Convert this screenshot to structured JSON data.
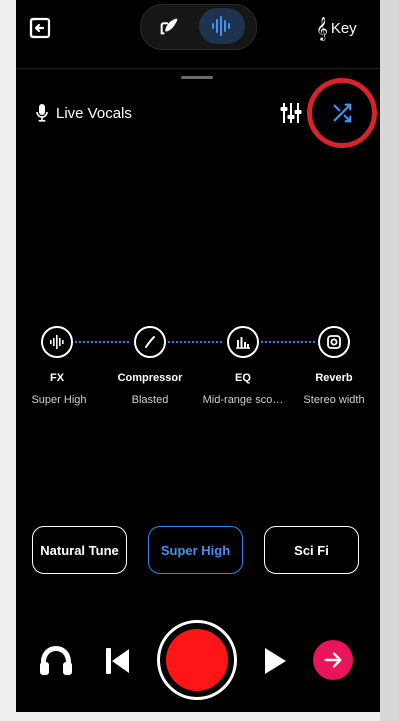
{
  "header": {
    "key_label": "Key",
    "icons": {
      "exit": "exit-icon",
      "edit": "edit-icon",
      "waveform": "waveform-icon",
      "key": "treble-clef-icon"
    }
  },
  "track": {
    "label": "Live Vocals",
    "icons": {
      "mic": "mic-icon",
      "mixer": "mixer-icon",
      "shuffle": "shuffle-icon"
    }
  },
  "chain": [
    {
      "name": "FX",
      "value": "Super High",
      "icon": "waveform-icon"
    },
    {
      "name": "Compressor",
      "value": "Blasted",
      "icon": "slash-icon"
    },
    {
      "name": "EQ",
      "value": "Mid-range sco…",
      "icon": "eq-bars-icon"
    },
    {
      "name": "Reverb",
      "value": "Stereo width",
      "icon": "reverb-icon"
    }
  ],
  "presets": [
    {
      "label": "Natural Tune",
      "active": false
    },
    {
      "label": "Super High",
      "active": true
    },
    {
      "label": "Sci Fi",
      "active": false
    }
  ],
  "transport": {
    "icons": [
      "headphones-icon",
      "skip-back-icon",
      "record-icon",
      "play-icon",
      "arrow-right-icon"
    ]
  },
  "colors": {
    "accent_blue": "#3b82e8",
    "record_red": "#ff1515",
    "next_pink": "#e8145c",
    "highlight_ring": "#d8232a"
  }
}
